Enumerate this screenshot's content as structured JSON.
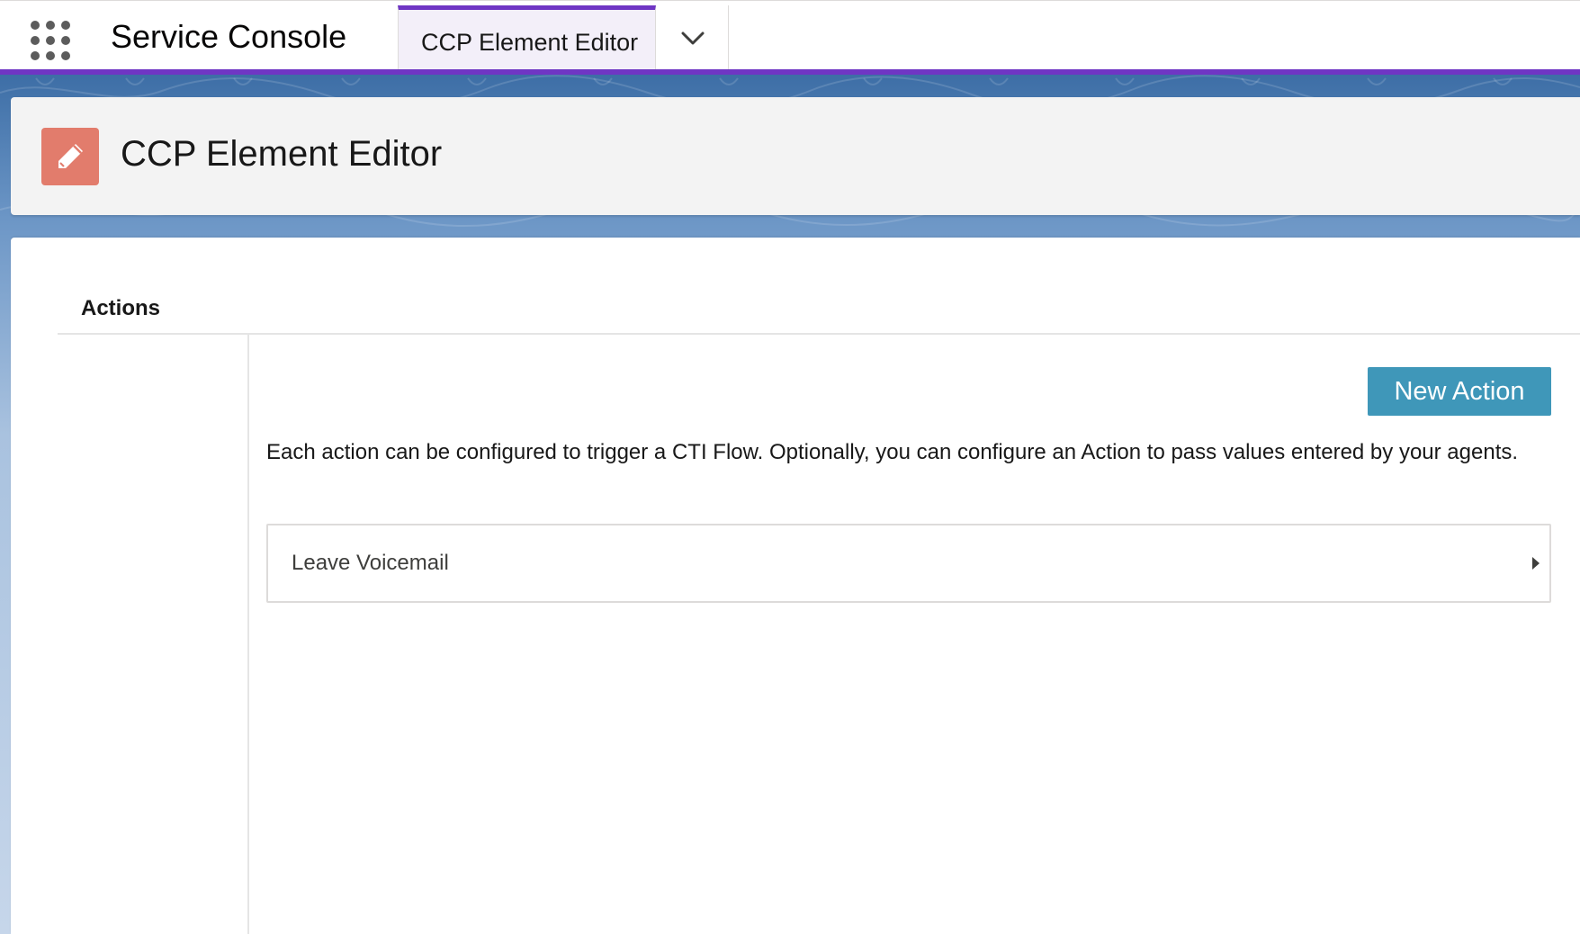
{
  "app": {
    "name": "Service Console",
    "launcher_icon": "app-launcher-grid-icon"
  },
  "nav": {
    "tabs": [
      {
        "label": "CCP Element Editor",
        "active": true
      }
    ],
    "dropdown_icon": "chevron-down-icon",
    "accent_color": "#6f36c4"
  },
  "page": {
    "title": "CCP Element Editor",
    "icon": "pencil-icon",
    "icon_color": "#e27c6c"
  },
  "actions": {
    "section_title": "Actions",
    "new_button_label": "New Action",
    "button_color": "#3f97b9",
    "description": "Each action can be configured to trigger a CTI Flow. Optionally, you can configure an Action to pass values entered by your agents.",
    "items": [
      {
        "label": "Leave Voicemail",
        "icon": "chevron-right-icon"
      }
    ]
  }
}
